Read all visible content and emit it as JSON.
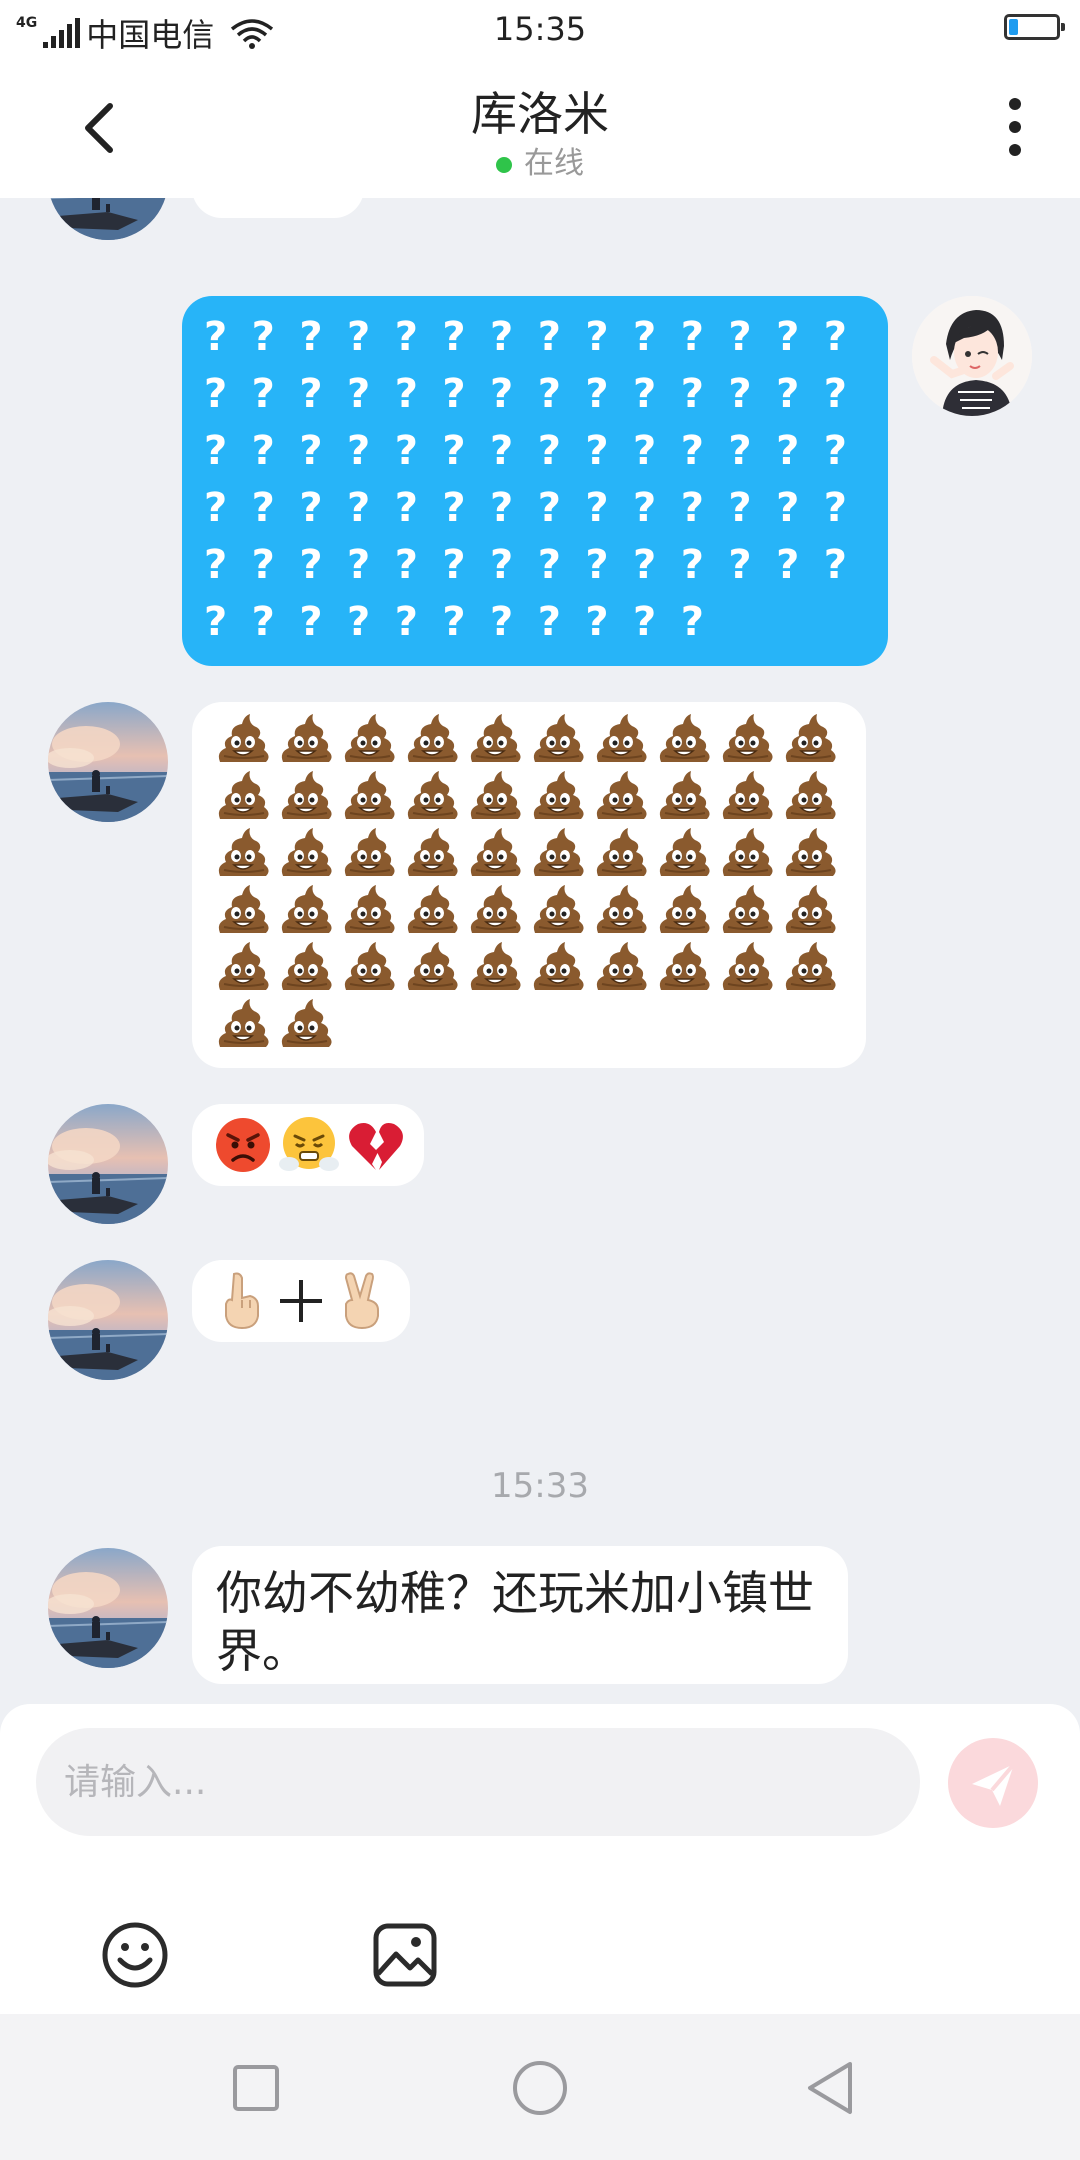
{
  "status_bar": {
    "network_badge": "4G",
    "carrier": "中国电信",
    "time": "15:35",
    "battery_level": 0.35
  },
  "header": {
    "title": "库洛米",
    "status": "在线",
    "status_color": "#2fc44a"
  },
  "messages": [
    {
      "side": "incoming",
      "kind": "emoji",
      "icon": "partially-visible-emoji-bubble"
    },
    {
      "side": "outgoing",
      "kind": "text",
      "chars": "?",
      "count": 81,
      "per_row": 14,
      "bubble_color": "#27b4f8"
    },
    {
      "side": "incoming",
      "kind": "emoji",
      "icon": "pile-of-poo-emoji",
      "count": 52,
      "per_row": 10
    },
    {
      "side": "incoming",
      "kind": "emoji",
      "icons": [
        "angry-face-emoji",
        "face-with-steam-emoji",
        "broken-heart-emoji"
      ]
    },
    {
      "side": "incoming",
      "kind": "emoji",
      "icons": [
        "index-finger-up-emoji",
        "plus-sign",
        "victory-hand-emoji"
      ]
    },
    {
      "side": "incoming",
      "kind": "text",
      "text": "你幼不幼稚？还玩米加小镇世界。"
    }
  ],
  "timestamp": "15:33",
  "composer": {
    "placeholder": "请输入...",
    "send_color": "#fbd9dc",
    "tools": [
      "smiley-icon",
      "image-icon"
    ]
  },
  "navbar": {
    "buttons": [
      "recents-square-icon",
      "home-circle-icon",
      "back-triangle-icon"
    ]
  }
}
